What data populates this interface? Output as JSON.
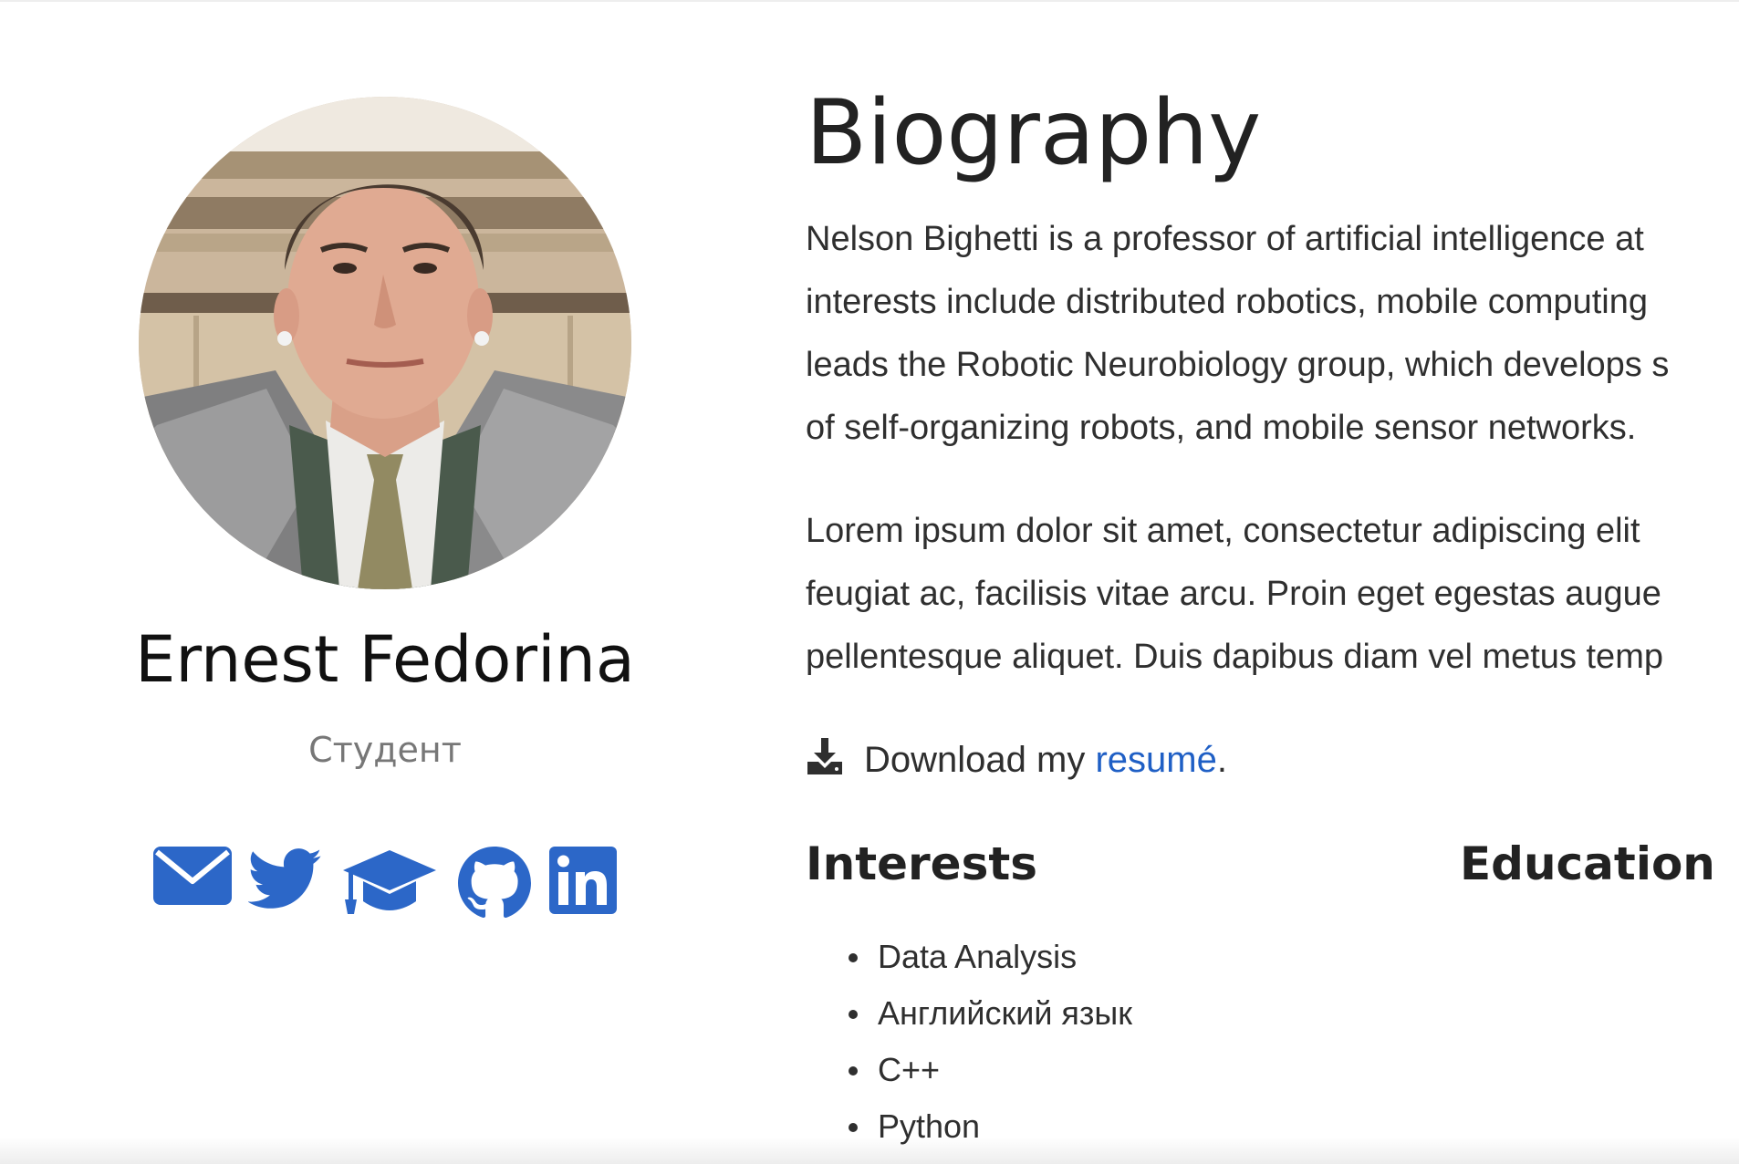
{
  "profile": {
    "name": "Ernest Fedorina",
    "role": "Студент",
    "avatar_alt": "Profile photo",
    "social_links": [
      {
        "icon": "envelope-icon",
        "label": "Email"
      },
      {
        "icon": "twitter-icon",
        "label": "Twitter"
      },
      {
        "icon": "graduation-cap-icon",
        "label": "Google Scholar"
      },
      {
        "icon": "github-icon",
        "label": "GitHub"
      },
      {
        "icon": "linkedin-icon",
        "label": "LinkedIn"
      }
    ]
  },
  "biography": {
    "title": "Biography",
    "paragraph1": [
      "Nelson Bighetti is a professor of artificial intelligence at",
      "interests include distributed robotics, mobile computing",
      "leads the Robotic Neurobiology group, which develops s",
      "of self-organizing robots, and mobile sensor networks."
    ],
    "paragraph2": [
      "Lorem ipsum dolor sit amet, consectetur adipiscing elit",
      "feugiat ac, facilisis vitae arcu. Proin eget egestas augue",
      "pellentesque aliquet. Duis dapibus diam vel metus temp"
    ],
    "download": {
      "prefix": "Download my ",
      "link_text": "resumé",
      "suffix": "."
    }
  },
  "interests": {
    "title": "Interests",
    "items": [
      "Data Analysis",
      "Английский язык",
      "C++",
      "Python"
    ]
  },
  "education": {
    "title": "Education"
  },
  "colors": {
    "accent": "#2c67c8",
    "link": "#1f5fc5",
    "text": "#2f2f2f",
    "muted": "#777777"
  }
}
